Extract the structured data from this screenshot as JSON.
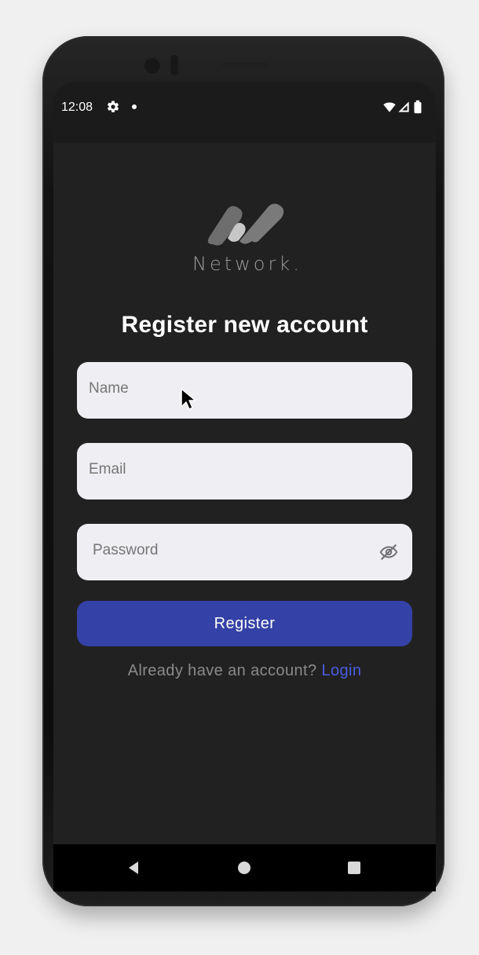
{
  "status_bar": {
    "time": "12:08",
    "left_icons": [
      "gear-icon",
      "dot-icon"
    ],
    "right_icons": [
      "wifi-icon",
      "signal-icon",
      "battery-icon"
    ]
  },
  "brand": {
    "name": "Network."
  },
  "page": {
    "title": "Register new account"
  },
  "form": {
    "name": {
      "placeholder": "Name",
      "value": ""
    },
    "email": {
      "placeholder": "Email",
      "value": ""
    },
    "password": {
      "placeholder": "Password",
      "value": "",
      "visibility_icon": "eye-off-icon"
    },
    "submit_label": "Register"
  },
  "footer": {
    "prompt": "Already have an account?",
    "login_label": "Login"
  },
  "navigation": {
    "buttons": [
      "back-icon",
      "home-icon",
      "recent-apps-icon"
    ]
  },
  "colors": {
    "background": "#212121",
    "status_bar": "#1b1b1b",
    "input_background": "#efeff3",
    "primary": "#3441a6",
    "link": "#4a5de0",
    "title": "#ffffff",
    "muted_text": "#8a8a8a"
  }
}
